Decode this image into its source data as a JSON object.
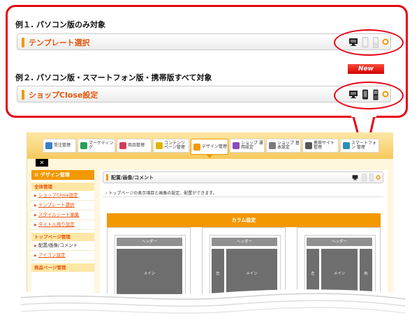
{
  "example1": {
    "title": "例１. パソコン版のみ対象",
    "bar_label": "テンプレート選択",
    "devices": [
      {
        "icon": "pc-monitor-icon",
        "state": "active"
      },
      {
        "icon": "smartphone-icon",
        "state": "inactive"
      },
      {
        "icon": "mobile-phone-icon",
        "state": "inactive"
      }
    ]
  },
  "example2": {
    "title": "例２. パソコン版・スマートフォン版・携帯版すべて対象",
    "bar_label": "ショップClose設定",
    "badge": "New",
    "devices": [
      {
        "icon": "pc-monitor-icon",
        "state": "active"
      },
      {
        "icon": "smartphone-icon",
        "state": "active"
      },
      {
        "icon": "mobile-phone-icon",
        "state": "active"
      }
    ]
  },
  "screenshot": {
    "nav_tabs": [
      {
        "label": "受注管理",
        "icon": "order-icon",
        "color": "#3b7fc4"
      },
      {
        "label": "マーケティング",
        "icon": "marketing-icon",
        "color": "#2a9d58"
      },
      {
        "label": "商品管理",
        "icon": "product-icon",
        "color": "#d63a5a"
      },
      {
        "label": "コンテンツ ページ管理",
        "icon": "content-page-icon",
        "color": "#e0b400"
      },
      {
        "label": "デザイン管理",
        "icon": "design-icon",
        "color": "#f39800"
      },
      {
        "label": "ショップ 運用設定",
        "icon": "shop-operation-icon",
        "color": "#8a4bb8"
      },
      {
        "label": "ショップ 基本設定",
        "icon": "shop-basic-icon",
        "color": "#7a7a7a"
      },
      {
        "label": "携帯サイト 管理",
        "icon": "mobile-site-icon",
        "color": "#555555"
      },
      {
        "label": "スマートフォン 管理",
        "icon": "smartphone-admin-icon",
        "color": "#2b8fb8"
      }
    ],
    "close_label": "✕",
    "sidebar": {
      "header": "デザイン管理",
      "sections": [
        {
          "title": "全体管理",
          "items": [
            "ショップClose設定",
            "テンプレート選択",
            "スタイルシート編集",
            "タイトル周り設定"
          ]
        },
        {
          "title": "トップページ管理",
          "items": [
            "配置/画像/コメント",
            "アイコン設定"
          ]
        },
        {
          "title": "商品ページ管理",
          "items": []
        }
      ],
      "current_item": "配置/画像/コメント"
    },
    "main": {
      "title": "配置/画像/コメント",
      "description": "トップページの表示項目と画像の設定、配置ができます。",
      "column_settings": "カラム設定",
      "layouts": [
        {
          "header": "ヘッダー",
          "blocks": [
            "メイン"
          ]
        },
        {
          "header": "ヘッダー",
          "blocks": [
            "左",
            "メイン"
          ]
        },
        {
          "header": "ヘッダー",
          "blocks": [
            "左",
            "メイン",
            "右"
          ]
        }
      ]
    }
  },
  "colors": {
    "accent_red": "#e60012",
    "accent_orange": "#f39800",
    "label_orange": "#e8540b"
  }
}
